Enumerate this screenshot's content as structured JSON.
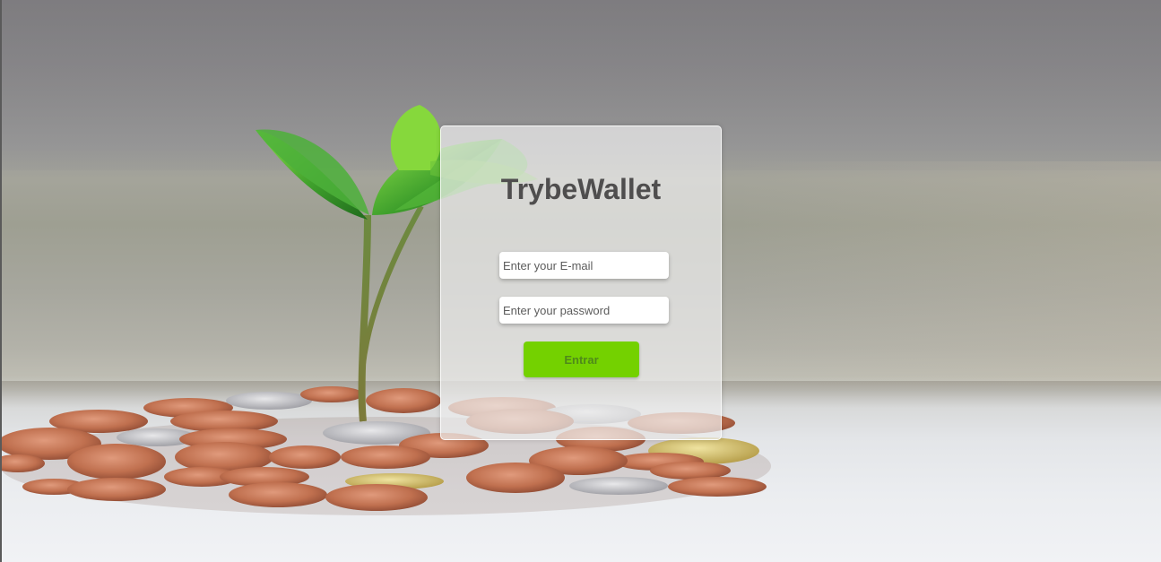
{
  "app": {
    "title": "TrybeWallet"
  },
  "login": {
    "email_placeholder": "Enter your E-mail",
    "email_value": "",
    "password_placeholder": "Enter your password",
    "password_value": "",
    "submit_label": "Entrar",
    "submit_disabled": true
  },
  "background": {
    "image": "plant-sprouting-from-coins-photo"
  },
  "colors": {
    "button_bg": "#74d100",
    "title": "#4f4e4e"
  }
}
